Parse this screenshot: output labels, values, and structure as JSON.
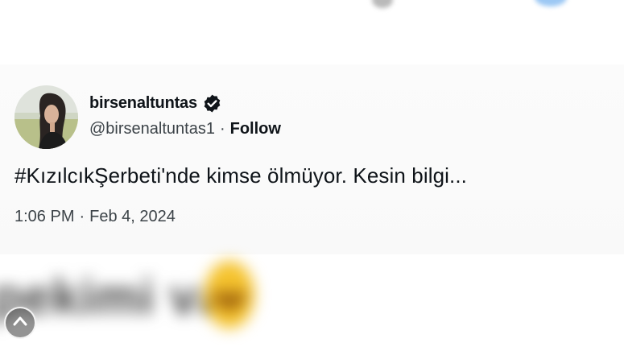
{
  "tweet": {
    "display_name": "birsenaltuntas",
    "verified_icon": "verified-badge-icon",
    "handle": "@birsenaltuntas1",
    "separator": "·",
    "follow_label": "Follow",
    "text": "#KızılcıkŞerbeti'nde kimse ölmüyor. Kesin bilgi...",
    "time": "1:06 PM",
    "date": "Feb 4, 2024"
  },
  "blurred_caption": {
    "text": "pekimi var"
  },
  "colors": {
    "text_primary": "#0f1419",
    "text_secondary": "#3c4348",
    "card_background": "#fafafa"
  },
  "icons": {
    "scroll_top": "chevron-up-icon",
    "avatar": "avatar"
  }
}
